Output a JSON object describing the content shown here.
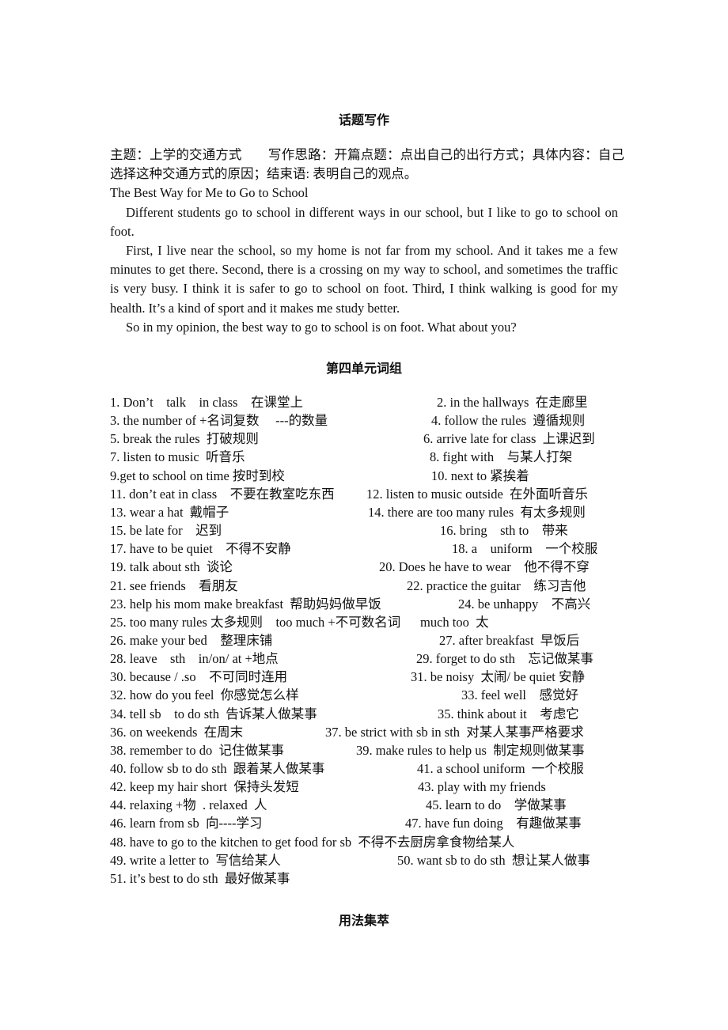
{
  "sections": {
    "writing": {
      "title": "话题写作",
      "intro": "主题：上学的交通方式　　写作思路：开篇点题：点出自己的出行方式；具体内容：自己选择这种交通方式的原因；结束语: 表明自己的观点。",
      "essay_title": "The Best Way for Me to Go to School",
      "paragraphs": [
        "Different students go to school in different ways in our school, but I like to go to school on foot.",
        "First, I live near the school, so my home is not far from my school. And it takes me a few minutes to get there. Second, there is a crossing on my way to school, and sometimes the traffic is very busy. I think it is safer to go to school on foot. Third, I think walking is good for my health. It’s a kind of sport and it makes me study better.",
        "So in my opinion, the best way to go to school is on foot. What about you?"
      ]
    },
    "phrases": {
      "title": "第四单元词组",
      "rows": [
        {
          "left": "1. Don’t    talk    in class    在课堂上",
          "right": "2. in the hallways  在走廊里"
        },
        {
          "left": "3. the number of +名词复数     ---的数量",
          "right": "4. follow the rules  遵循规则"
        },
        {
          "left": "5. break the rules  打破规则",
          "right": "6. arrive late for class  上课迟到"
        },
        {
          "left": "7. listen to music  听音乐",
          "right": "8. fight with    与某人打架"
        },
        {
          "left": "9.get to school on time 按时到校",
          "right": "10. next to 紧挨着"
        },
        {
          "left": "11. don’t eat in class    不要在教室吃东西",
          "right": "12. listen to music outside  在外面听音乐"
        },
        {
          "left": "13. wear a hat  戴帽子",
          "right": "14. there are too many rules  有太多规则"
        },
        {
          "left": "15. be late for    迟到",
          "right": "16. bring    sth to    带来"
        },
        {
          "left": "17. have to be quiet    不得不安静",
          "right": "18. a    uniform    一个校服"
        },
        {
          "left": "19. talk about sth  谈论",
          "right": "20. Does he have to wear    他不得不穿"
        },
        {
          "left": "21. see friends    看朋友",
          "right": "22. practice the guitar    练习吉他"
        },
        {
          "left": "23. help his mom make breakfast  帮助妈妈做早饭",
          "right": "24. be unhappy    不高兴"
        },
        {
          "left": "25. too many rules 太多规则    too much +不可数名词      much too  太",
          "right": ""
        },
        {
          "left": "26. make your bed    整理床铺",
          "right": "27. after breakfast  早饭后"
        },
        {
          "left": "28. leave    sth    in/on/ at +地点",
          "right": "29. forget to do sth    忘记做某事"
        },
        {
          "left": "30. because / .so    不可同时连用",
          "right": "31. be noisy  太闹/ be quiet 安静"
        },
        {
          "left": "32. how do you feel  你感觉怎么样",
          "right": "33. feel well    感觉好"
        },
        {
          "left": "34. tell sb    to do sth  告诉某人做某事",
          "right": "35. think about it    考虑它"
        },
        {
          "left": "36. on weekends  在周末",
          "right": "37. be strict with sb in sth  对某人某事严格要求"
        },
        {
          "left": "38. remember to do  记住做某事",
          "right": "39. make rules to help us  制定规则做某事"
        },
        {
          "left": "40. follow sb to do sth  跟着某人做某事",
          "right": "41. a school uniform  一个校服"
        },
        {
          "left": "42. keep my hair short  保持头发短",
          "right": "43. play with my friends"
        },
        {
          "left": "44. relaxing +物  . relaxed  人",
          "right": "45. learn to do    学做某事"
        },
        {
          "left": "46. learn from sb  向----学习",
          "right": "47. have fun doing    有趣做某事"
        },
        {
          "left": "48. have to go to the kitchen to get food for sb  不得不去厨房拿食物给某人",
          "right": ""
        },
        {
          "left": "49. write a letter to  写信给某人",
          "right": "50. want sb to do sth  想让某人做事"
        },
        {
          "left": "51. it’s best to do sth  最好做某事",
          "right": ""
        }
      ]
    },
    "usage": {
      "title": "用法集萃"
    }
  }
}
